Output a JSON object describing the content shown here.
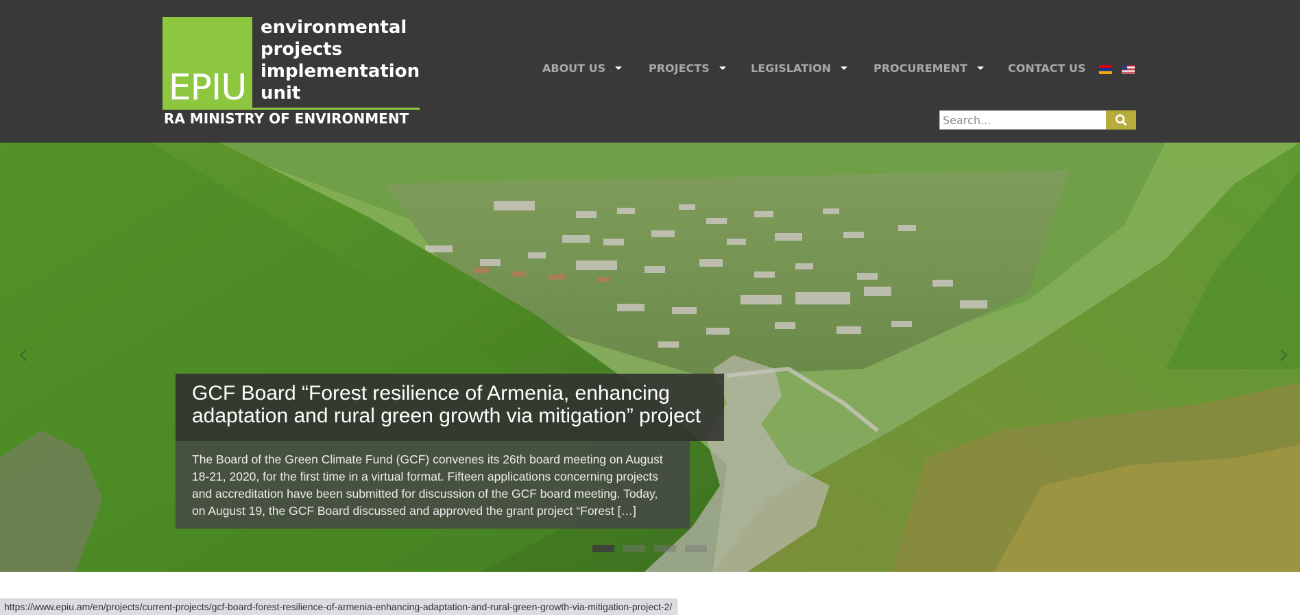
{
  "logo": {
    "box_text": "EPIU",
    "line1": "environmental",
    "line2": "projects",
    "line3": "implementation",
    "line4": "unit",
    "ministry": "RA MINISTRY OF ENVIRONMENT"
  },
  "nav": {
    "items": [
      {
        "label": "ABOUT US",
        "dropdown": true
      },
      {
        "label": "PROJECTS",
        "dropdown": true
      },
      {
        "label": "LEGISLATION",
        "dropdown": true
      },
      {
        "label": "PROCUREMENT",
        "dropdown": true
      },
      {
        "label": "CONTACT US",
        "dropdown": false
      }
    ],
    "languages": [
      "armenian-flag-icon",
      "us-flag-icon"
    ]
  },
  "search": {
    "placeholder": "Search...",
    "button_icon": "search-icon"
  },
  "slider": {
    "title": "GCF Board “Forest resilience of Armenia, enhancing adaptation and rural green growth via mitigation” project",
    "excerpt": "The Board of the Green Climate Fund (GCF) convenes its 26th board meeting on August 18-21, 2020, for the first time in a virtual format. Fifteen applications concerning projects and accreditation have been submitted for discussion of the GCF board meeting. Today, on August 19, the GCF Board discussed and approved the grant project “Forest […]",
    "slide_count": 4,
    "active_slide": 1
  },
  "status_bar": {
    "url": "https://www.epiu.am/en/projects/current-projects/gcf-board-forest-resilience-of-armenia-enhancing-adaptation-and-rural-green-growth-via-mitigation-project-2/"
  },
  "colors": {
    "header_bg": "#393939",
    "logo_green": "#8dc63f",
    "nav_text": "#a8a8a8",
    "search_button": "#b7ac3c"
  }
}
